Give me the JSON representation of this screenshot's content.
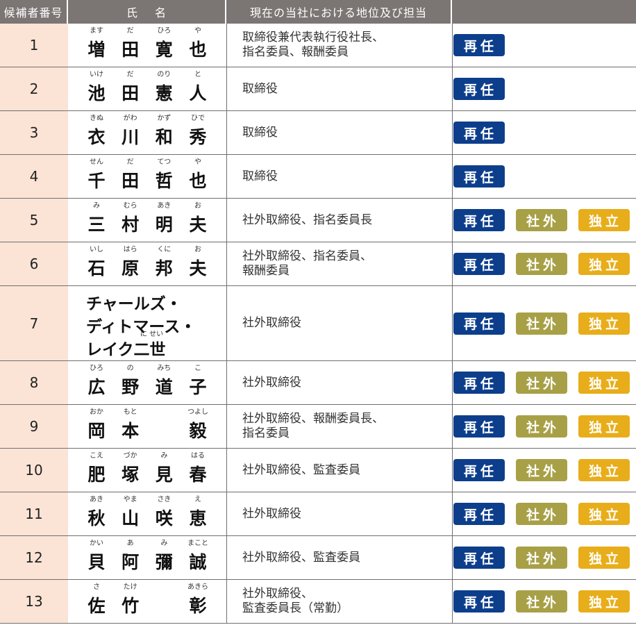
{
  "header": {
    "number": "候補者番号",
    "name_a": "氏",
    "name_b": "名",
    "position": "現在の当社における地位及び担当",
    "tags": ""
  },
  "badges": {
    "reappoint": "再任",
    "outside": "社外",
    "independent": "独立",
    "reappoint_color": "#0d3e8c",
    "outside_color": "#a8a046",
    "independent_color": "#e8ad1a"
  },
  "candidates": [
    {
      "num": "1",
      "chars": [
        {
          "k": "増",
          "r": "ます"
        },
        {
          "k": "田",
          "r": "だ"
        },
        {
          "k": "寛",
          "r": "ひろ"
        },
        {
          "k": "也",
          "r": "や"
        }
      ],
      "pos": [
        "取締役兼代表執行役社長、",
        "指名委員、報酬委員"
      ],
      "tags": [
        "reappoint"
      ]
    },
    {
      "num": "2",
      "chars": [
        {
          "k": "池",
          "r": "いけ"
        },
        {
          "k": "田",
          "r": "だ"
        },
        {
          "k": "憲",
          "r": "のり"
        },
        {
          "k": "人",
          "r": "と"
        }
      ],
      "pos": [
        "取締役"
      ],
      "tags": [
        "reappoint"
      ]
    },
    {
      "num": "3",
      "chars": [
        {
          "k": "衣",
          "r": "きぬ"
        },
        {
          "k": "川",
          "r": "がわ"
        },
        {
          "k": "和",
          "r": "かず"
        },
        {
          "k": "秀",
          "r": "ひで"
        }
      ],
      "pos": [
        "取締役"
      ],
      "tags": [
        "reappoint"
      ]
    },
    {
      "num": "4",
      "chars": [
        {
          "k": "千",
          "r": "せん"
        },
        {
          "k": "田",
          "r": "だ"
        },
        {
          "k": "哲",
          "r": "てつ"
        },
        {
          "k": "也",
          "r": "や"
        }
      ],
      "pos": [
        "取締役"
      ],
      "tags": [
        "reappoint"
      ]
    },
    {
      "num": "5",
      "chars": [
        {
          "k": "三",
          "r": "み"
        },
        {
          "k": "村",
          "r": "むら"
        },
        {
          "k": "明",
          "r": "あき"
        },
        {
          "k": "夫",
          "r": "お"
        }
      ],
      "pos": [
        "社外取締役、指名委員長"
      ],
      "tags": [
        "reappoint",
        "outside",
        "independent"
      ]
    },
    {
      "num": "6",
      "chars": [
        {
          "k": "石",
          "r": "いし"
        },
        {
          "k": "原",
          "r": "はら"
        },
        {
          "k": "邦",
          "r": "くに"
        },
        {
          "k": "夫",
          "r": "お"
        }
      ],
      "pos": [
        "社外取締役、指名委員、",
        "報酬委員"
      ],
      "tags": [
        "reappoint",
        "outside",
        "independent"
      ]
    },
    {
      "num": "7",
      "long": [
        "チャールズ・",
        "ディトマース・",
        "レイク二世"
      ],
      "long_ruby": "に せい",
      "pos": [
        "社外取締役"
      ],
      "tags": [
        "reappoint",
        "outside",
        "independent"
      ]
    },
    {
      "num": "8",
      "chars": [
        {
          "k": "広",
          "r": "ひろ"
        },
        {
          "k": "野",
          "r": "の"
        },
        {
          "k": "道",
          "r": "みち"
        },
        {
          "k": "子",
          "r": "こ"
        }
      ],
      "pos": [
        "社外取締役"
      ],
      "tags": [
        "reappoint",
        "outside",
        "independent"
      ]
    },
    {
      "num": "9",
      "chars": [
        {
          "k": "岡",
          "r": "おか"
        },
        {
          "k": "本",
          "r": "もと"
        },
        {
          "k": "",
          "r": ""
        },
        {
          "k": "毅",
          "r": "つよし"
        }
      ],
      "pos": [
        "社外取締役、報酬委員長、",
        "指名委員"
      ],
      "tags": [
        "reappoint",
        "outside",
        "independent"
      ]
    },
    {
      "num": "10",
      "chars": [
        {
          "k": "肥",
          "r": "こえ"
        },
        {
          "k": "塚",
          "r": "づか"
        },
        {
          "k": "見",
          "r": "み"
        },
        {
          "k": "春",
          "r": "はる"
        }
      ],
      "pos": [
        "社外取締役、監査委員"
      ],
      "tags": [
        "reappoint",
        "outside",
        "independent"
      ]
    },
    {
      "num": "11",
      "chars": [
        {
          "k": "秋",
          "r": "あき"
        },
        {
          "k": "山",
          "r": "やま"
        },
        {
          "k": "咲",
          "r": "さき"
        },
        {
          "k": "恵",
          "r": "え"
        }
      ],
      "pos": [
        "社外取締役"
      ],
      "tags": [
        "reappoint",
        "outside",
        "independent"
      ]
    },
    {
      "num": "12",
      "chars": [
        {
          "k": "貝",
          "r": "かい"
        },
        {
          "k": "阿",
          "r": "あ"
        },
        {
          "k": "彌",
          "r": "み"
        },
        {
          "k": "誠",
          "r": "まこと"
        }
      ],
      "pos": [
        "社外取締役、監査委員"
      ],
      "tags": [
        "reappoint",
        "outside",
        "independent"
      ]
    },
    {
      "num": "13",
      "chars": [
        {
          "k": "佐",
          "r": "さ"
        },
        {
          "k": "竹",
          "r": "たけ"
        },
        {
          "k": "",
          "r": ""
        },
        {
          "k": "彰",
          "r": "あきら"
        }
      ],
      "pos": [
        "社外取締役、",
        "監査委員長（常勤）"
      ],
      "tags": [
        "reappoint",
        "outside",
        "independent"
      ]
    }
  ]
}
